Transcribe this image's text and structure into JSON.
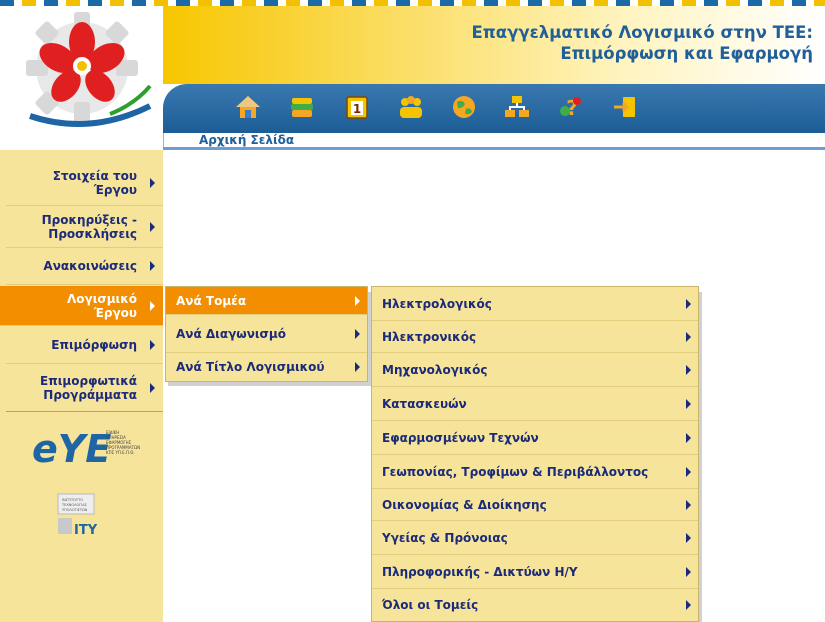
{
  "header": {
    "title_line1": "Επαγγελματικό Λογισμικό στην ΤΕΕ:",
    "title_line2": "Επιμόρφωση και Εφαρμογή",
    "breadcrumb": "Αρχική Σελίδα"
  },
  "toolbar": {
    "icons": [
      "home-icon",
      "books-icon",
      "calendar-icon",
      "people-icon",
      "globe-icon",
      "network-icon",
      "help-icon",
      "login-icon"
    ],
    "calendar_digit": "1"
  },
  "sidebar": {
    "items": [
      {
        "label": "Στοιχεία του Έργου"
      },
      {
        "label": "Προκηρύξεις - Προσκλήσεις"
      },
      {
        "label": "Ανακοινώσεις"
      },
      {
        "label": "Λογισμικό Έργου"
      },
      {
        "label": "Επιμόρφωση"
      },
      {
        "label": "Επιμορφωτικά Προγράμματα"
      }
    ]
  },
  "submenu1": {
    "items": [
      {
        "label": "Ανά Τομέα"
      },
      {
        "label": "Ανά Διαγωνισμό"
      },
      {
        "label": "Ανά Τίτλο Λογισμικού"
      }
    ]
  },
  "submenu2": {
    "items": [
      {
        "label": "Ηλεκτρολογικός"
      },
      {
        "label": "Ηλεκτρονικός"
      },
      {
        "label": "Μηχανολογικός"
      },
      {
        "label": "Κατασκευών"
      },
      {
        "label": "Εφαρμοσμένων Τεχνών"
      },
      {
        "label": "Γεωπονίας, Τροφίμων & Περιβάλλοντος"
      },
      {
        "label": "Οικονομίας & Διοίκησης"
      },
      {
        "label": "Υγείας & Πρόνοιας"
      },
      {
        "label": "Πληροφορικής - Δικτύων Η/Υ"
      },
      {
        "label": "Όλοι οι Τομείς"
      }
    ]
  },
  "logos": {
    "eye_text": "eYE",
    "eye_caption": "ΕΙΔΙΚΗ ΥΠΗΡΕΣΙΑ ΕΦΑΡΜΟΓΗΣ ΠΡΟΓΡΑΜΜΑΤΩΝ ΚΠΣ ΥΠ.Ε.Π.Θ.",
    "ity_text": "ΙΤΥ",
    "ity_caption": "ΙΝΣΤΙΤΟΥΤΟ ΤΕΧΝΟΛΟΓΙΑΣ ΥΠΟΛΟΓΙΣΤΩΝ"
  },
  "colors": {
    "accent_orange": "#f28e00",
    "menu_bg": "#f6e49a",
    "nav_blue": "#1f65a4",
    "text_navy": "#1b2a7a"
  }
}
